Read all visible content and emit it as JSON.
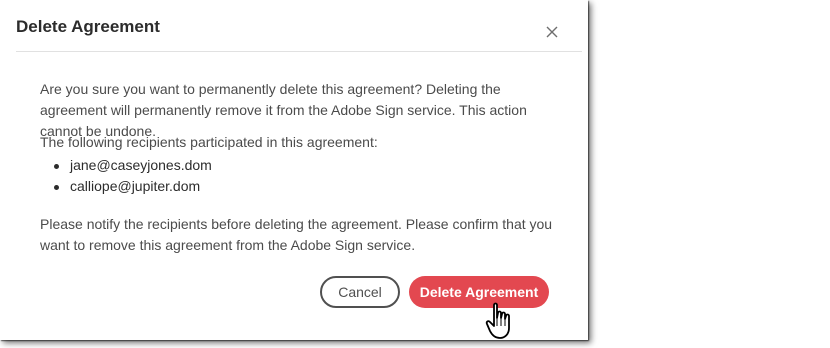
{
  "dialog": {
    "title": "Delete Agreement",
    "close_icon": "close-icon",
    "paragraph_1": "Are you sure you want to permanently delete this agreement? Deleting the agreement will permanently remove it from the Adobe Sign service. This action cannot be undone.",
    "paragraph_2": "The following recipients participated in this agreement:",
    "recipients": [
      "jane@caseyjones.dom",
      "calliope@jupiter.dom"
    ],
    "paragraph_3": "Please notify the recipients before deleting the agreement. Please confirm that you want to remove this agreement from the Adobe Sign service.",
    "cancel_label": "Cancel",
    "delete_label": "Delete Agreement",
    "cursor_icon": "hand-pointer-icon"
  },
  "colors": {
    "delete_button": "#e34850",
    "cancel_border": "#505050",
    "title_text": "#2c2c2c",
    "body_text": "#4b4b4b"
  }
}
